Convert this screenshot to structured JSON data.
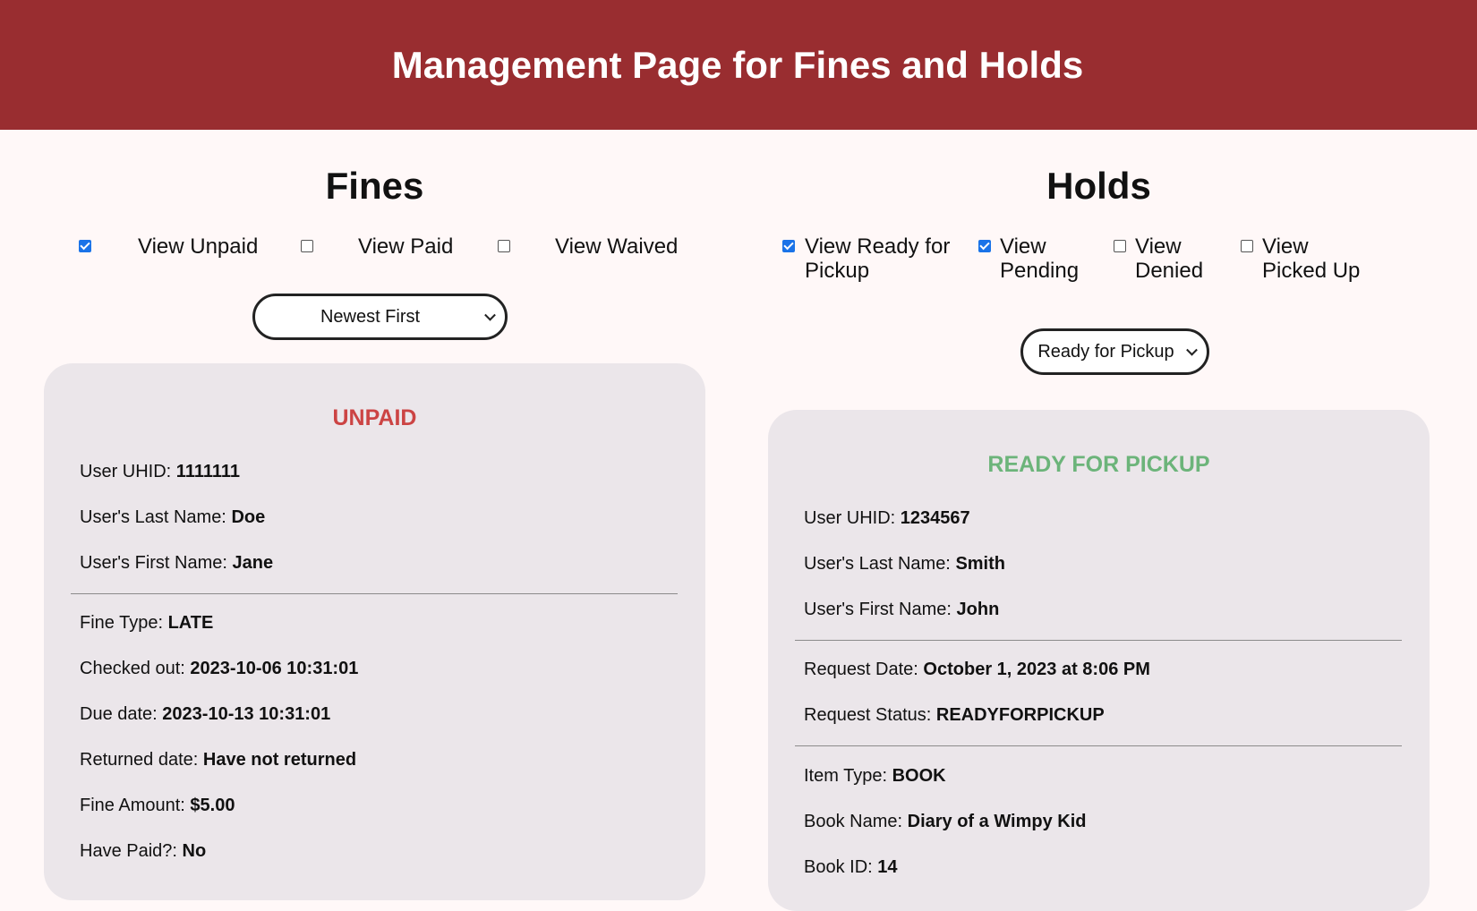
{
  "header": {
    "title": "Management Page for Fines and Holds",
    "background_color": "#992d30"
  },
  "fines": {
    "title": "Fines",
    "filters": [
      {
        "label": "View Unpaid",
        "checked": true
      },
      {
        "label": "View Paid",
        "checked": false
      },
      {
        "label": "View Waived",
        "checked": false
      }
    ],
    "sort": {
      "selected": "Newest First"
    },
    "card": {
      "status": "UNPAID",
      "status_color": "#cc4444",
      "user_uhid": {
        "label": "User UHID:",
        "value": "1111111"
      },
      "last_name": {
        "label": "User's Last Name:",
        "value": "Doe"
      },
      "first_name": {
        "label": "User's First Name:",
        "value": "Jane"
      },
      "fine_type": {
        "label": "Fine Type:",
        "value": "LATE"
      },
      "checked_out": {
        "label": "Checked out:",
        "value": "2023-10-06 10:31:01"
      },
      "due_date": {
        "label": "Due date:",
        "value": "2023-10-13 10:31:01"
      },
      "returned_date": {
        "label": "Returned date:",
        "value": "Have not returned"
      },
      "fine_amount": {
        "label": "Fine Amount:",
        "value": "$5.00"
      },
      "have_paid": {
        "label": "Have Paid?:",
        "value": "No"
      }
    }
  },
  "holds": {
    "title": "Holds",
    "filters": [
      {
        "label_line1": "View Ready for",
        "label_line2": "Pickup",
        "checked": true
      },
      {
        "label_line1": "View",
        "label_line2": "Pending",
        "checked": true
      },
      {
        "label_line1": "View",
        "label_line2": "Denied",
        "checked": false
      },
      {
        "label_line1": "View",
        "label_line2": "Picked Up",
        "checked": false
      }
    ],
    "sort": {
      "selected": "Ready for Pickup"
    },
    "card": {
      "status": "READY FOR PICKUP",
      "status_color": "#6cb47a",
      "user_uhid": {
        "label": "User UHID:",
        "value": "1234567"
      },
      "last_name": {
        "label": "User's Last Name:",
        "value": "Smith"
      },
      "first_name": {
        "label": "User's First Name:",
        "value": "John"
      },
      "request_date": {
        "label": "Request Date:",
        "value": "October 1, 2023 at 8:06 PM"
      },
      "request_status": {
        "label": "Request Status:",
        "value": "READYFORPICKUP"
      },
      "item_type": {
        "label": "Item Type:",
        "value": "BOOK"
      },
      "book_name": {
        "label": "Book Name:",
        "value": "Diary of a Wimpy Kid"
      },
      "book_id": {
        "label": "Book ID:",
        "value": "14"
      }
    }
  }
}
